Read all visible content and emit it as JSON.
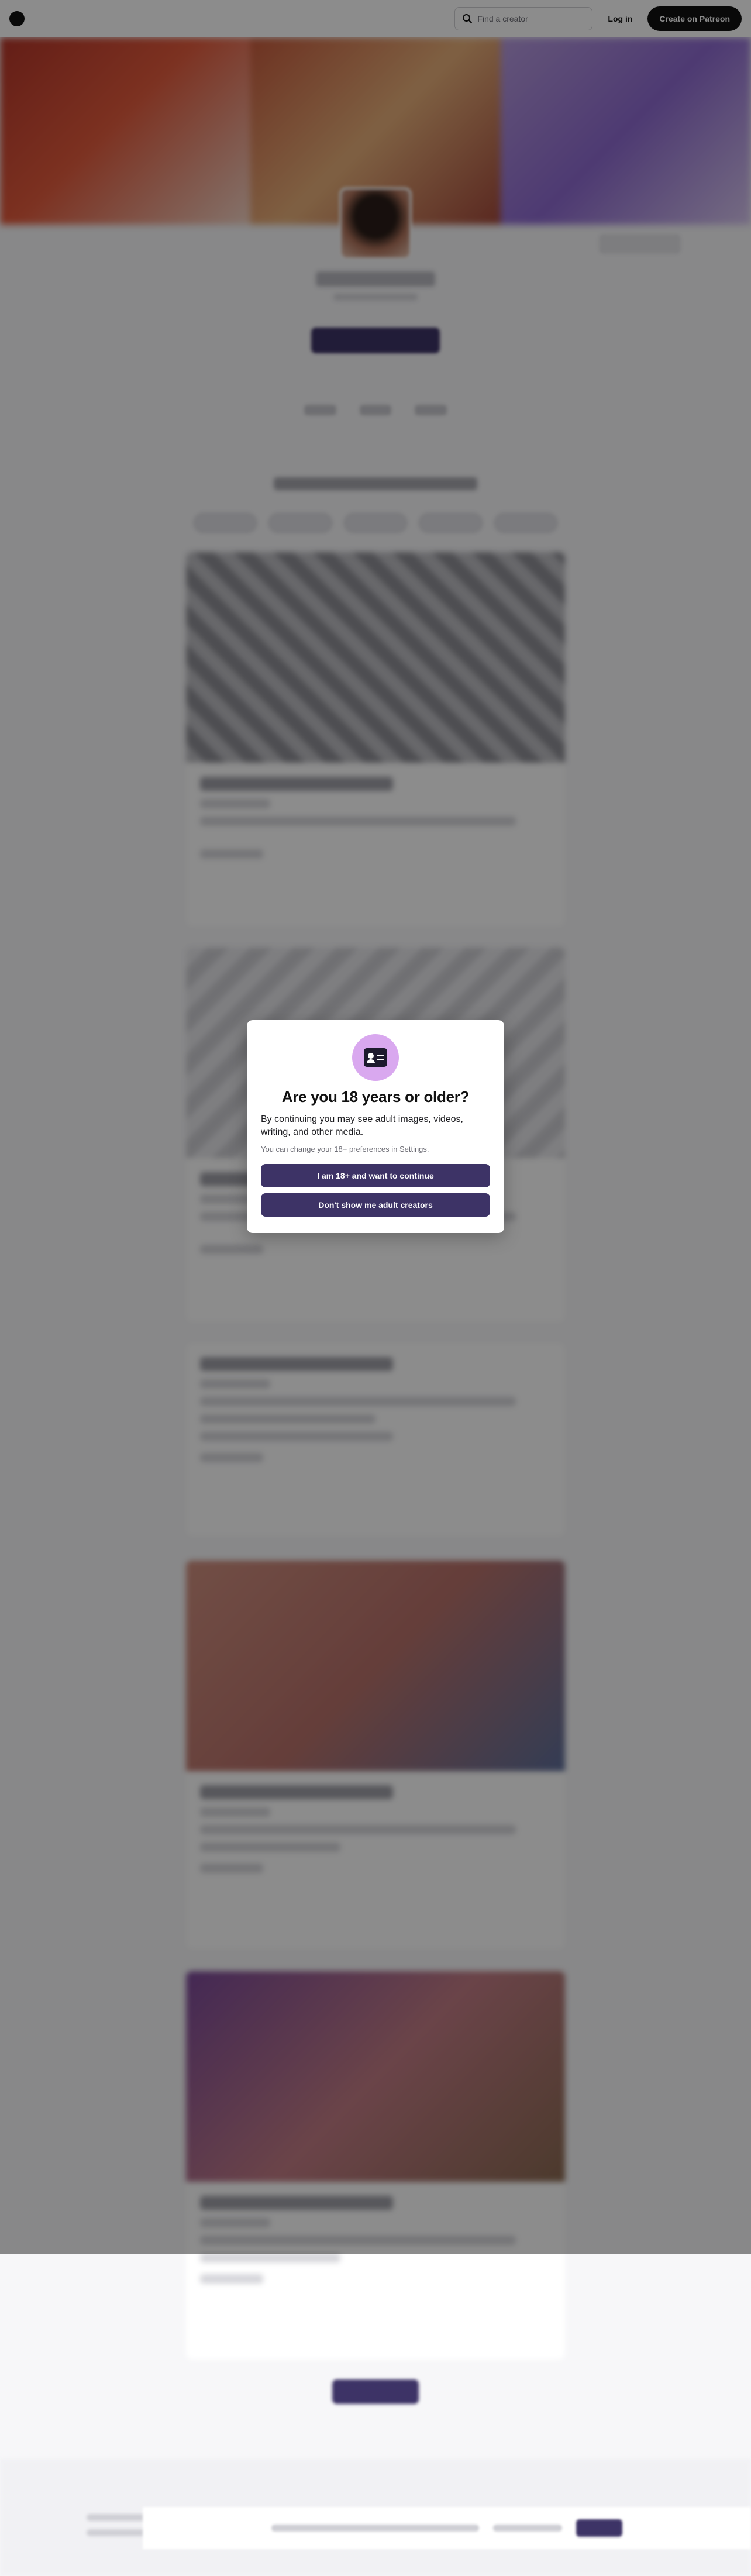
{
  "nav": {
    "search_placeholder": "Find a creator",
    "login_label": "Log in",
    "create_label": "Create on Patreon"
  },
  "modal": {
    "title": "Are you 18 years or older?",
    "description": "By continuing you may see adult images, videos, writing, and other media.",
    "note": "You can change your 18+ preferences in Settings.",
    "confirm_label": "I am 18+ and want to continue",
    "decline_label": "Don't show me adult creators",
    "icon": "id-card-icon"
  },
  "colors": {
    "primary_button": "#3d3366",
    "icon_circle": "#d9a8ef",
    "overlay": "rgba(0,0,0,0.45)"
  }
}
